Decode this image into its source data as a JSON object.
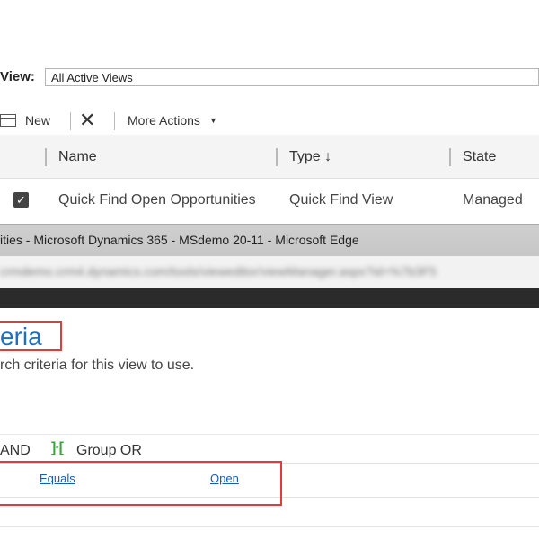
{
  "view": {
    "label": "View:",
    "selected": "All Active Views"
  },
  "toolbar": {
    "new_label": "New",
    "more_actions_label": "More Actions"
  },
  "grid": {
    "columns": [
      "Name",
      "Type ↓",
      "State"
    ],
    "rows": [
      {
        "checked": true,
        "name": "Quick Find Open Opportunities",
        "type": "Quick Find View",
        "state": "Managed"
      }
    ]
  },
  "browser": {
    "title": "ities - Microsoft Dynamics 365 - MSdemo 20-11 - Microsoft Edge",
    "address": "crmdemo.crm4.dynamics.com/tools/vieweditor/viewManager.aspx?id=%7b3F5"
  },
  "criteria": {
    "title": "eria",
    "description": "rch criteria for this view to use.",
    "group_and_label": "AND",
    "group_or_label": "Group OR",
    "condition": {
      "operator": "Equals",
      "value": "Open"
    }
  },
  "colors": {
    "accent": "#1f6fbf",
    "highlight": "#e33b3b",
    "group_or_icon": "#3aa53a",
    "link": "#1a5bb8"
  },
  "icons": [
    "new-icon",
    "close-icon",
    "chevron-down-icon",
    "checkbox-checked-icon",
    "group-or-icon"
  ]
}
